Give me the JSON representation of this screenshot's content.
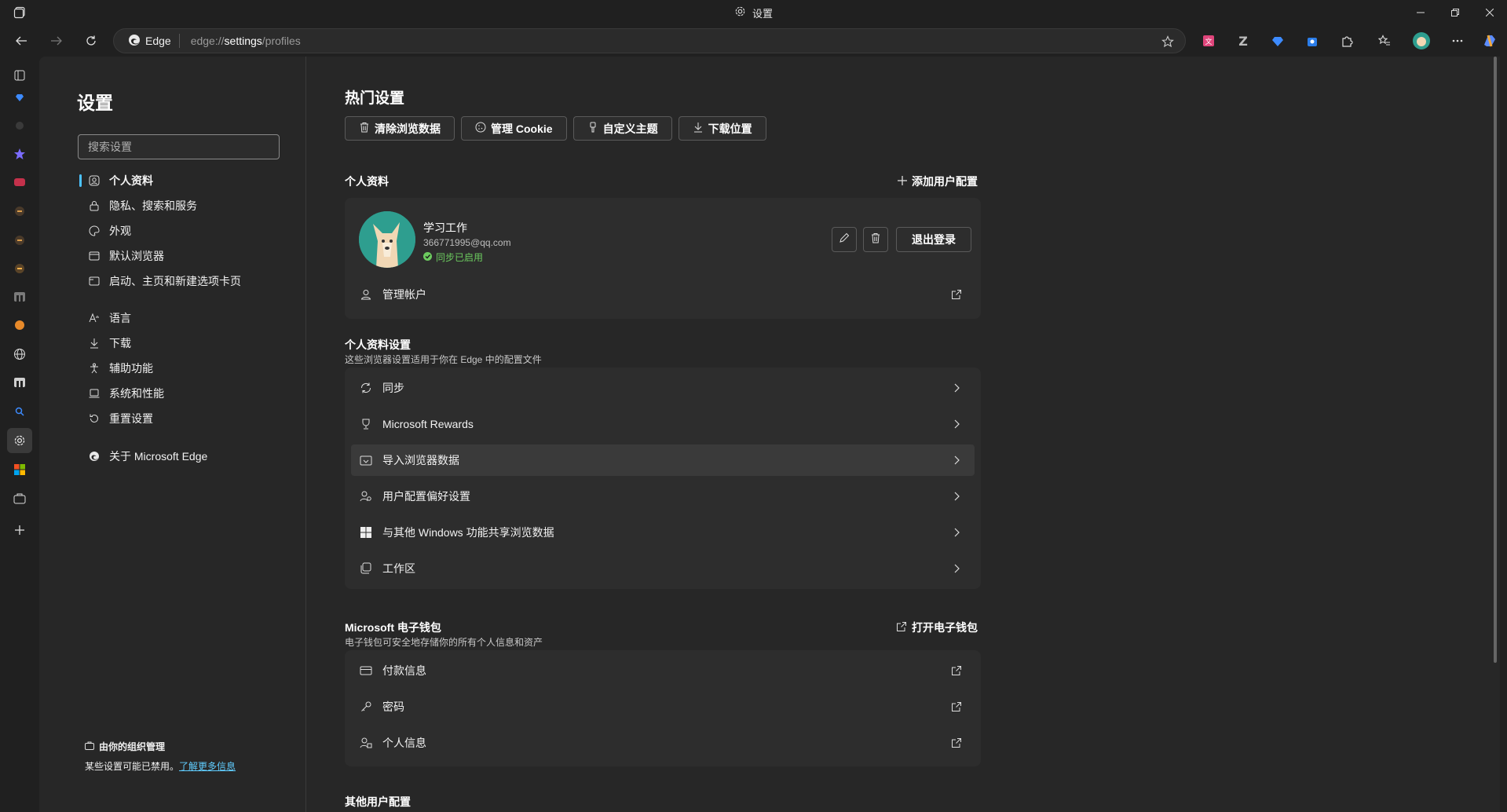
{
  "window": {
    "title": "设置"
  },
  "address": {
    "badge": "Edge",
    "url_prefix": "edge://",
    "url_main": "settings",
    "url_suffix": "/profiles"
  },
  "nav": {
    "title": "设置",
    "search_placeholder": "搜索设置",
    "items": [
      {
        "label": "个人资料",
        "icon": "profile-icon",
        "active": true
      },
      {
        "label": "隐私、搜索和服务",
        "icon": "lock-icon"
      },
      {
        "label": "外观",
        "icon": "palette-icon"
      },
      {
        "label": "默认浏览器",
        "icon": "browser-icon"
      },
      {
        "label": "启动、主页和新建选项卡页",
        "icon": "startup-icon"
      },
      {
        "label": "语言",
        "icon": "language-icon"
      },
      {
        "label": "下载",
        "icon": "download-icon"
      },
      {
        "label": "辅助功能",
        "icon": "accessibility-icon"
      },
      {
        "label": "系统和性能",
        "icon": "system-icon"
      },
      {
        "label": "重置设置",
        "icon": "reset-icon"
      },
      {
        "label": "关于 Microsoft Edge",
        "icon": "edge-icon"
      }
    ],
    "org_title": "由你的组织管理",
    "org_text": "某些设置可能已禁用。",
    "org_link": "了解更多信息"
  },
  "main": {
    "hot_title": "热门设置",
    "quick": [
      "清除浏览数据",
      "管理 Cookie",
      "自定义主题",
      "下载位置"
    ],
    "profile_label": "个人资料",
    "add_profile": "添加用户配置",
    "profile": {
      "name": "学习工作",
      "email": "366771995@qq.com",
      "sync": "同步已启用",
      "signout": "退出登录",
      "manage": "管理帐户"
    },
    "profile_settings_label": "个人资料设置",
    "profile_settings_sub": "这些浏览器设置适用于你在 Edge 中的配置文件",
    "profile_settings": [
      "同步",
      "Microsoft Rewards",
      "导入浏览器数据",
      "用户配置偏好设置",
      "与其他 Windows 功能共享浏览数据",
      "工作区"
    ],
    "wallet_label": "Microsoft 电子钱包",
    "wallet_sub": "电子钱包可安全地存储你的所有个人信息和资产",
    "wallet_open": "打开电子钱包",
    "wallet": [
      "付款信息",
      "密码",
      "个人信息"
    ],
    "other_label": "其他用户配置"
  },
  "colors": {
    "accent": "#4cc2ff",
    "sync_green": "#6ccb5f",
    "background": "#272727",
    "card": "#2d2d2d"
  }
}
